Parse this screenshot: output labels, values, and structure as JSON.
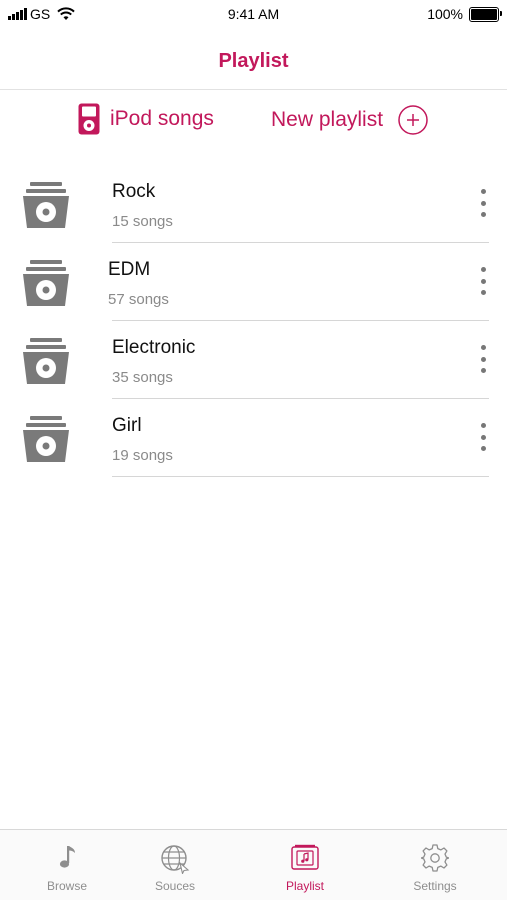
{
  "status_bar": {
    "carrier": "GS",
    "time": "9:41 AM",
    "battery": "100%"
  },
  "nav": {
    "title": "Playlist"
  },
  "actions": {
    "ipod_label": "iPod songs",
    "new_playlist_label": "New playlist"
  },
  "playlists": [
    {
      "title": "Rock",
      "subtitle": "15 songs"
    },
    {
      "title": "EDM",
      "subtitle": "57 songs"
    },
    {
      "title": "Electronic",
      "subtitle": "35 songs"
    },
    {
      "title": "Girl",
      "subtitle": "19 songs"
    }
  ],
  "tabs": [
    {
      "label": "Browse",
      "icon": "music-note-icon"
    },
    {
      "label": "Souces",
      "icon": "globe-icon"
    },
    {
      "label": "Playlist",
      "icon": "playlist-icon"
    },
    {
      "label": "Settings",
      "icon": "gear-icon"
    }
  ],
  "colors": {
    "accent": "#c2185b",
    "icon_gray": "#777777",
    "subtitle_gray": "#8a8a8a"
  }
}
